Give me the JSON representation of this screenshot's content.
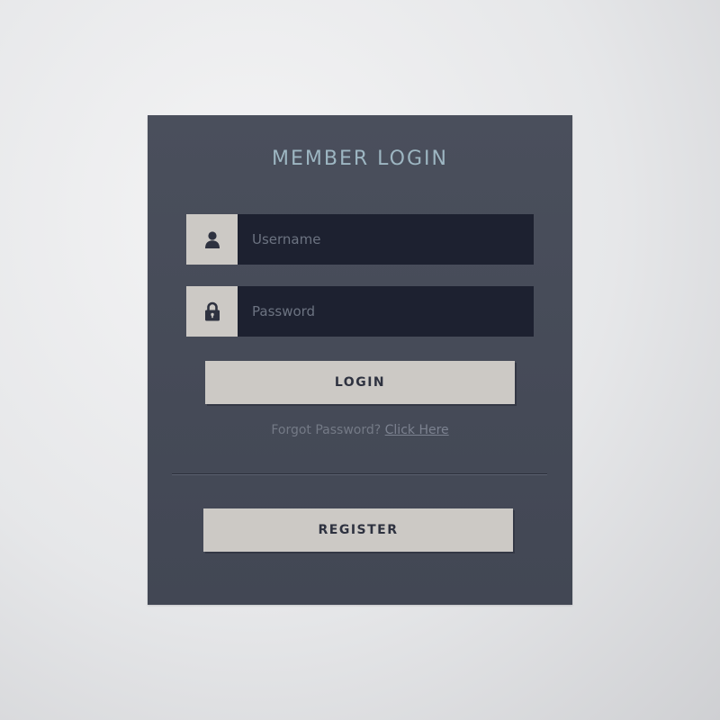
{
  "form": {
    "title": "MEMBER LOGIN",
    "username": {
      "placeholder": "Username",
      "value": "",
      "icon": "user-icon"
    },
    "password": {
      "placeholder": "Password",
      "value": "",
      "icon": "lock-icon"
    },
    "login_label": "LOGIN",
    "forgot_text": "Forgot Password?",
    "forgot_link": "Click Here",
    "register_label": "REGISTER"
  },
  "colors": {
    "card_background": "#464b58",
    "input_background": "#1d2130",
    "button_background": "#ccc9c5",
    "title_color": "#9db6c2",
    "page_background": "#e6e7e9"
  }
}
